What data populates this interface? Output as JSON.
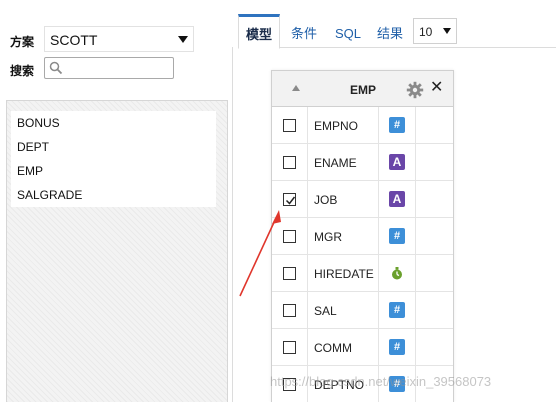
{
  "left": {
    "schema_label": "方案",
    "schema_value": "SCOTT",
    "search_label": "搜索",
    "search_placeholder": "",
    "tables": [
      "BONUS",
      "DEPT",
      "EMP",
      "SALGRADE"
    ]
  },
  "tabs": [
    {
      "label": "模型",
      "active": true
    },
    {
      "label": "条件",
      "active": false
    },
    {
      "label": "SQL",
      "active": false
    },
    {
      "label": "结果",
      "active": false
    }
  ],
  "limit_value": "10",
  "emp_table": {
    "title": "EMP",
    "columns": [
      {
        "name": "EMPNO",
        "type_icon": "number-icon",
        "checked": false
      },
      {
        "name": "ENAME",
        "type_icon": "string-icon",
        "checked": false
      },
      {
        "name": "JOB",
        "type_icon": "string-icon",
        "checked": true
      },
      {
        "name": "MGR",
        "type_icon": "number-icon",
        "checked": false
      },
      {
        "name": "HIREDATE",
        "type_icon": "date-icon",
        "checked": false
      },
      {
        "name": "SAL",
        "type_icon": "number-icon",
        "checked": false
      },
      {
        "name": "COMM",
        "type_icon": "number-icon",
        "checked": false
      },
      {
        "name": "DEPTNO",
        "type_icon": "number-icon",
        "checked": false
      }
    ]
  },
  "icons": {
    "number_glyph": "#",
    "string_glyph": "A"
  },
  "colors": {
    "number_icon": "#3d8fd8",
    "string_icon": "#6a46a8",
    "date_icon": "#6aa02c",
    "active_tab_border": "#2f73bf",
    "annotation_arrow": "#e0362c"
  },
  "watermark": "https://blog.csdn.net/weixin_39568073"
}
